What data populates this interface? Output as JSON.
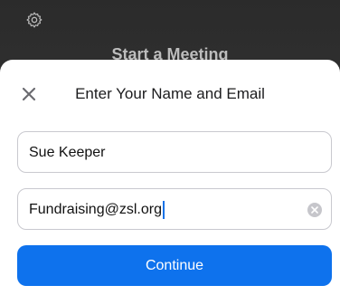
{
  "background": {
    "title": "Start a Meeting",
    "gear_icon": "gear-icon"
  },
  "dialog": {
    "title": "Enter Your Name and Email",
    "close_icon": "close-icon"
  },
  "form": {
    "name_value": "Sue Keeper",
    "email_value": "Fundraising@zsl.org",
    "clear_icon": "clear-text-icon"
  },
  "actions": {
    "continue_label": "Continue"
  },
  "colors": {
    "accent": "#0e72ed",
    "backdrop": "#2f2f2f"
  }
}
